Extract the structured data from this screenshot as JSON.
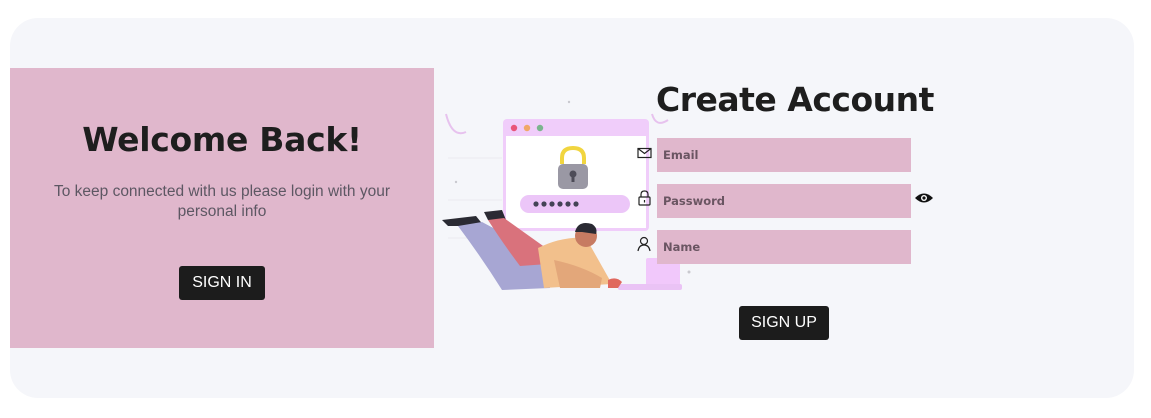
{
  "welcome": {
    "title": "Welcome Back!",
    "message": "To keep connected with us please login with your personal info",
    "signin_label": "SIGN IN"
  },
  "illustration": {
    "password_dots": "••••••"
  },
  "signup": {
    "title": "Create Account",
    "fields": [
      {
        "name": "email",
        "placeholder": "Email",
        "icon": "envelope-icon"
      },
      {
        "name": "password",
        "placeholder": "Password",
        "icon": "lock-icon"
      },
      {
        "name": "name",
        "placeholder": "Name",
        "icon": "user-icon"
      }
    ],
    "signup_label": "SIGN UP"
  },
  "colors": {
    "panel": "#e0b7cc",
    "card": "#f5f6fa",
    "button": "#1c1c1c"
  }
}
